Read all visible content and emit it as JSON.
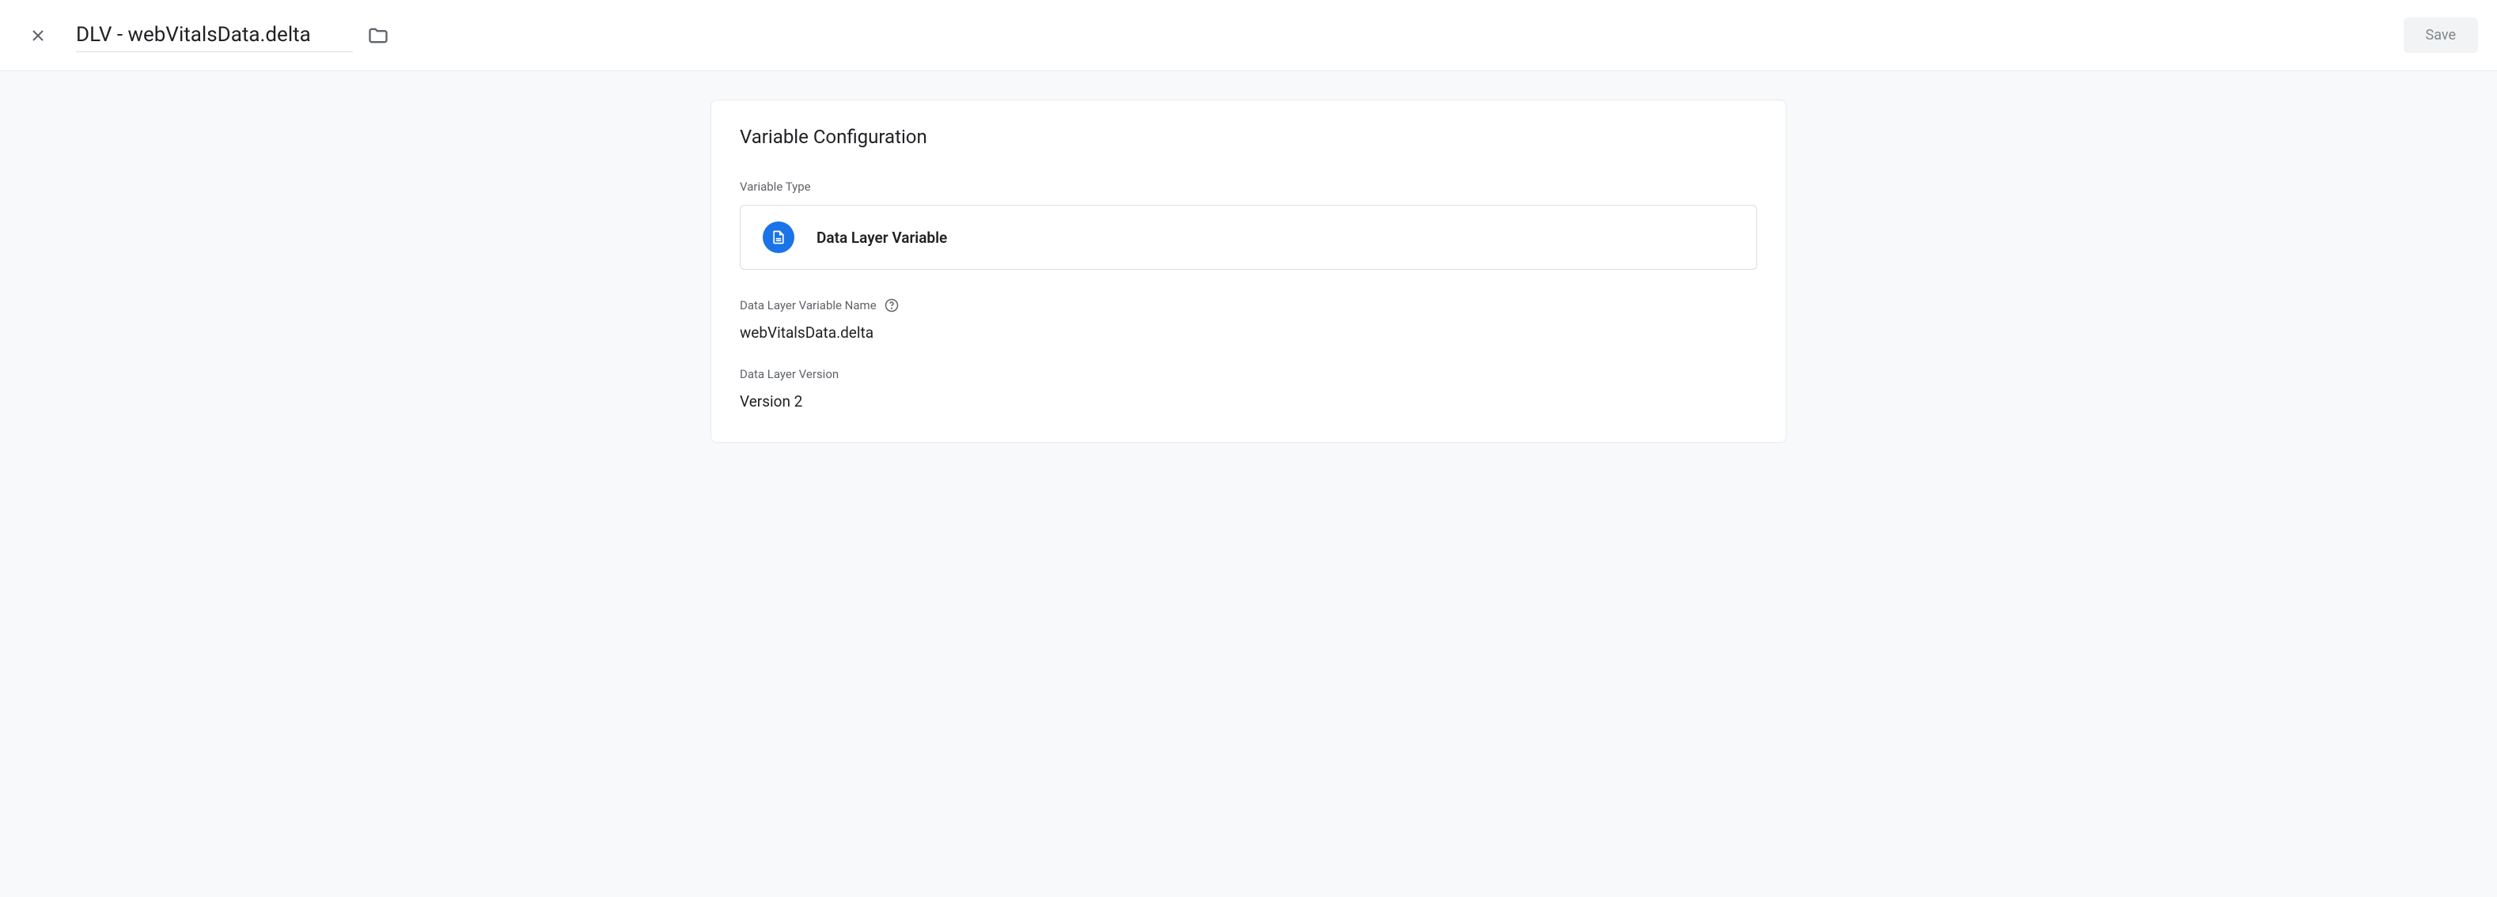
{
  "header": {
    "title": "DLV - webVitalsData.delta",
    "save_label": "Save"
  },
  "card": {
    "title": "Variable Configuration",
    "variable_type_label": "Variable Type",
    "variable_type_name": "Data Layer Variable",
    "variable_name_label": "Data Layer Variable Name",
    "variable_name_value": "webVitalsData.delta",
    "version_label": "Data Layer Version",
    "version_value": "Version 2"
  }
}
